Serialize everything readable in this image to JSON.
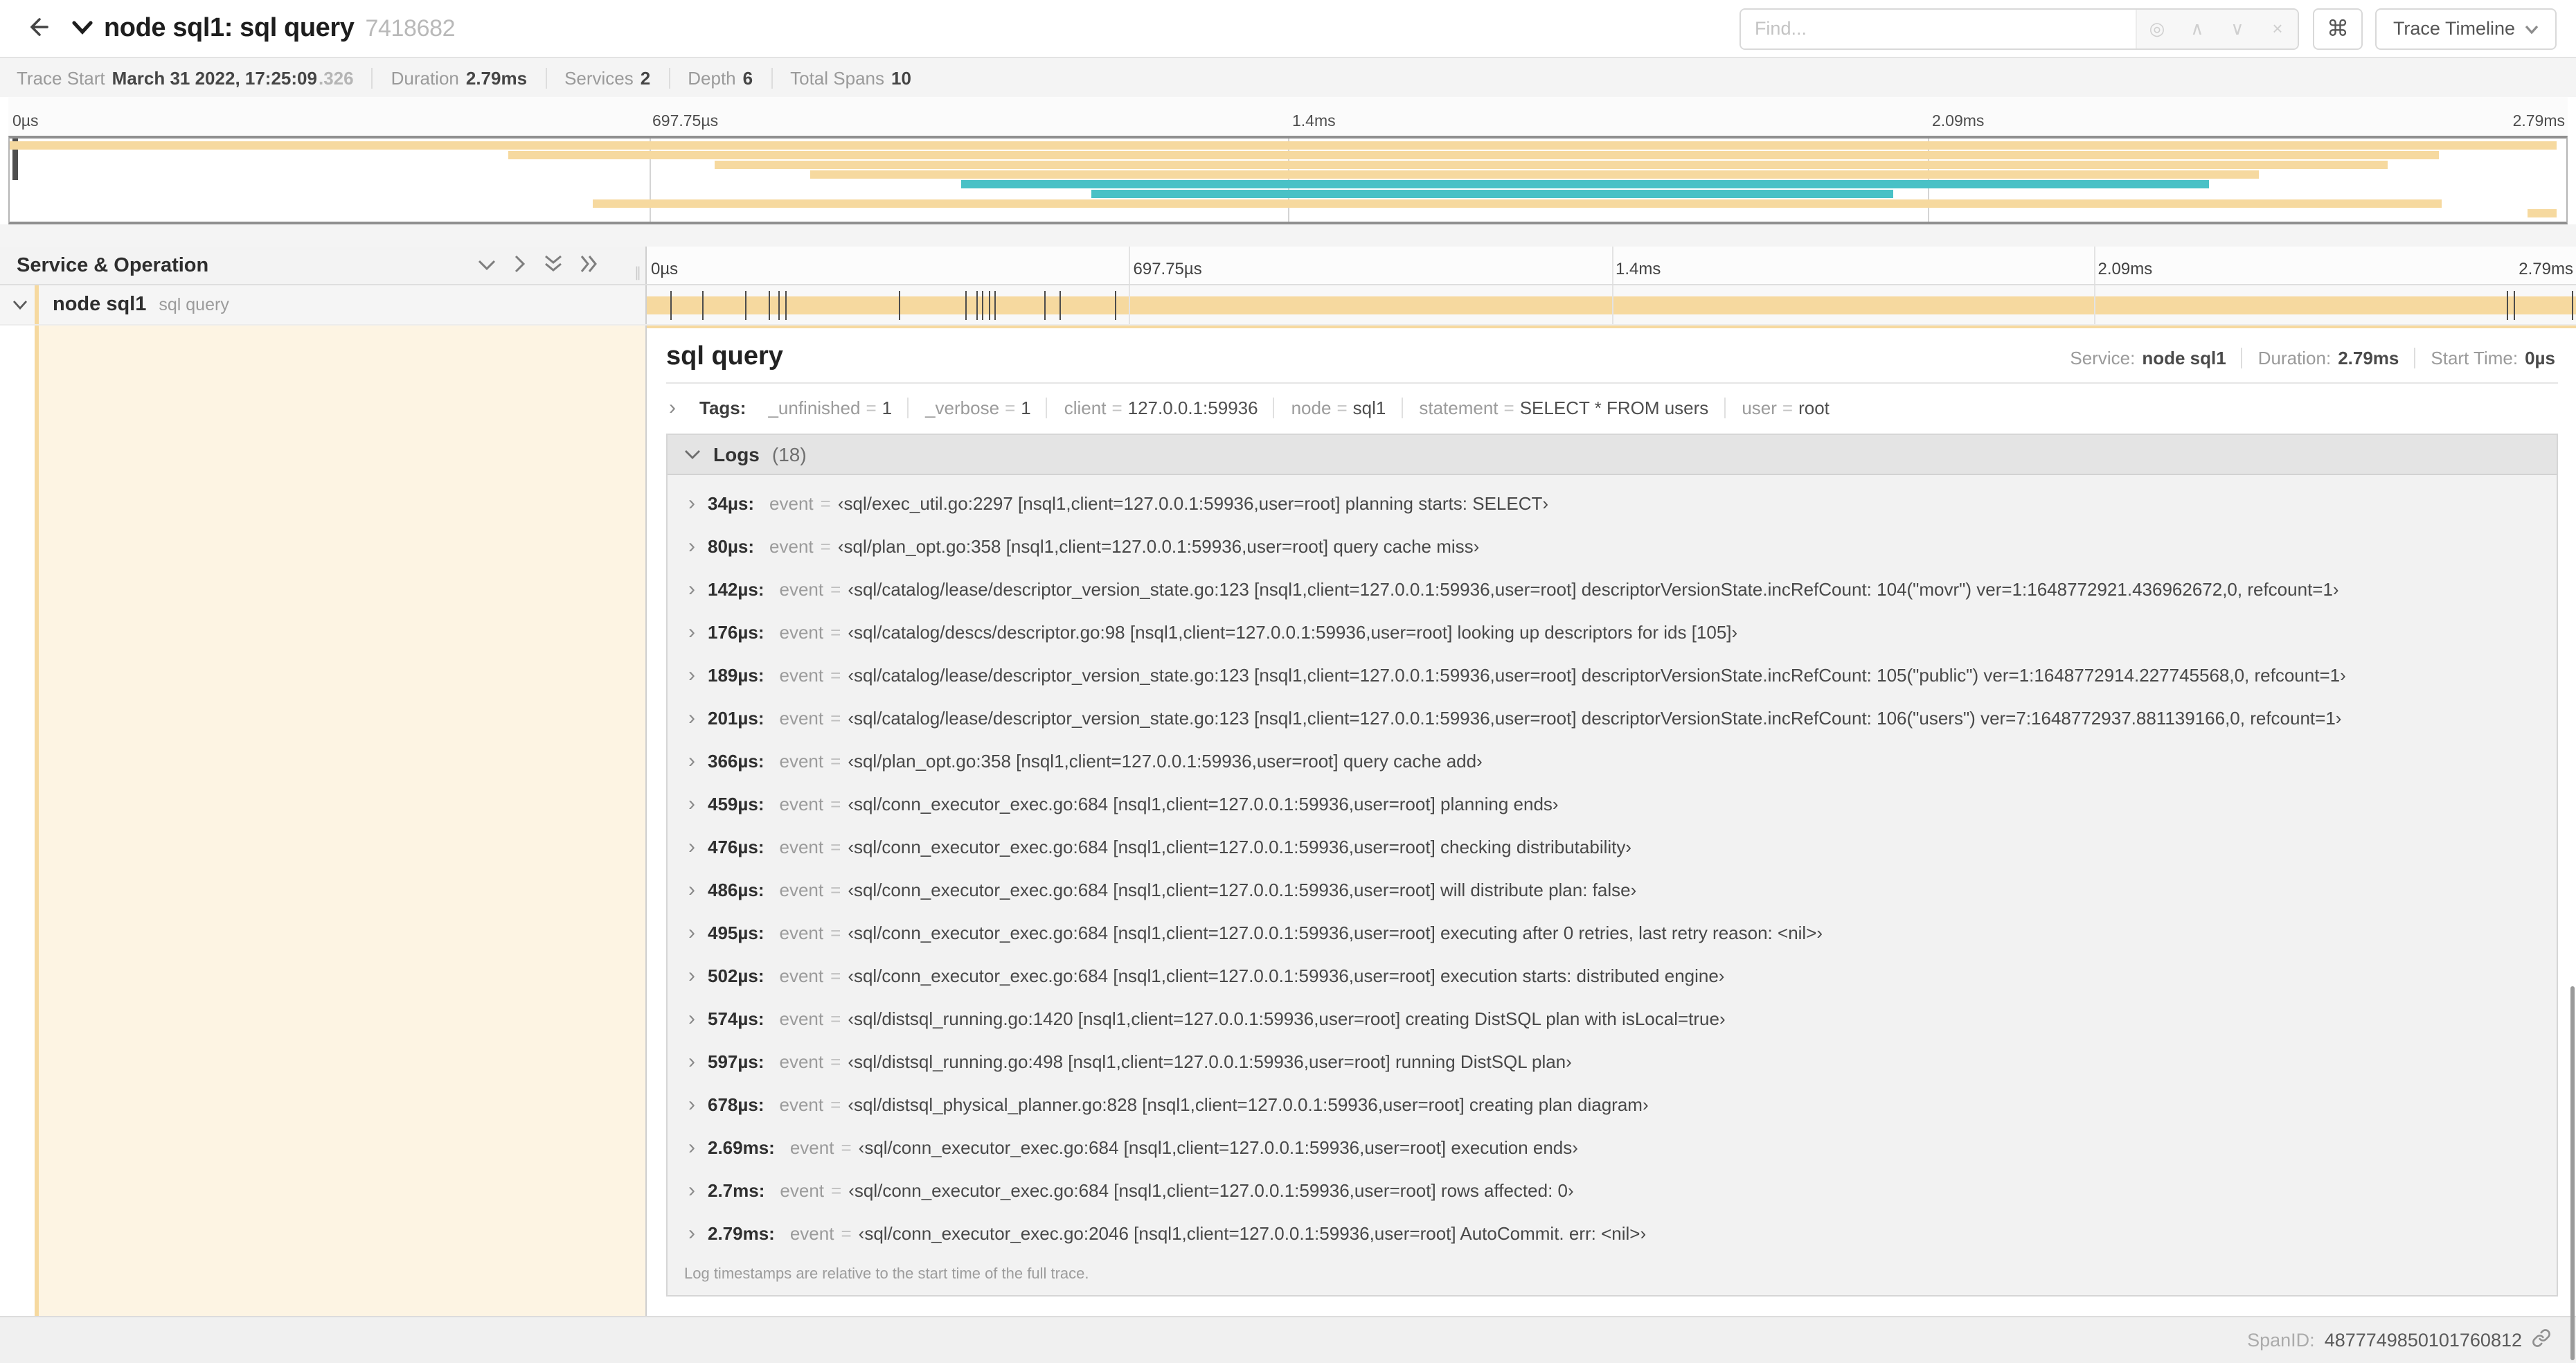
{
  "header": {
    "title": "node sql1: sql query",
    "trace_id": "7418682",
    "find_placeholder": "Find...",
    "view_selector_label": "Trace Timeline"
  },
  "icons": {
    "back": "←",
    "command": "⌘",
    "chevron_right": "›",
    "target": "◎",
    "caret_up": "∧",
    "caret_down": "∨",
    "close": "×",
    "grip": "∥"
  },
  "trace_meta": {
    "items": [
      {
        "label": "Trace Start",
        "value": "March 31 2022, 17:25:09",
        "suffix": ".326"
      },
      {
        "label": "Duration",
        "value": "2.79ms"
      },
      {
        "label": "Services",
        "value": "2"
      },
      {
        "label": "Depth",
        "value": "6"
      },
      {
        "label": "Total Spans",
        "value": "10"
      }
    ]
  },
  "ruler_ticks": [
    "0µs",
    "697.75µs",
    "1.4ms",
    "2.09ms",
    "2.79ms"
  ],
  "colors": {
    "span_tan": "#f6d99f",
    "span_teal": "#49c1c6",
    "cream_bg": "#fdf4e3"
  },
  "minimap": {
    "bars": [
      {
        "row": 0,
        "start": 0.0,
        "end": 0.996,
        "color": "tan"
      },
      {
        "row": 1,
        "start": 0.195,
        "end": 0.95,
        "color": "tan"
      },
      {
        "row": 2,
        "start": 0.276,
        "end": 0.93,
        "color": "tan"
      },
      {
        "row": 3,
        "start": 0.313,
        "end": 0.88,
        "color": "tan"
      },
      {
        "row": 4,
        "start": 0.372,
        "end": 0.86,
        "color": "teal"
      },
      {
        "row": 5,
        "start": 0.423,
        "end": 0.737,
        "color": "teal"
      },
      {
        "row": 6,
        "start": 0.228,
        "end": 0.951,
        "color": "tan"
      },
      {
        "row": 7,
        "start": 0.985,
        "end": 0.996,
        "color": "tan"
      }
    ]
  },
  "timeline": {
    "header_label": "Service & Operation",
    "span_row": {
      "service": "node sql1",
      "operation": "sql query"
    },
    "log_tick_fractions": [
      0.012,
      0.029,
      0.051,
      0.063,
      0.068,
      0.072,
      0.131,
      0.165,
      0.171,
      0.174,
      0.177,
      0.18,
      0.206,
      0.214,
      0.243,
      0.964,
      0.968,
      0.998
    ]
  },
  "detail": {
    "operation": "sql query",
    "eq": "=",
    "meta": [
      {
        "label": "Service:",
        "value": "node sql1"
      },
      {
        "label": "Duration:",
        "value": "2.79ms"
      },
      {
        "label": "Start Time:",
        "value": "0µs"
      }
    ],
    "tags_label": "Tags:",
    "tags": [
      {
        "key": "_unfinished",
        "value": "1"
      },
      {
        "key": "_verbose",
        "value": "1"
      },
      {
        "key": "client",
        "value": "127.0.0.1:59936"
      },
      {
        "key": "node",
        "value": "sql1"
      },
      {
        "key": "statement",
        "value": "SELECT * FROM users"
      },
      {
        "key": "user",
        "value": "root"
      }
    ],
    "logs_label": "Logs",
    "logs_count": "(18)",
    "logs": [
      {
        "time": "34µs:",
        "key": "event",
        "value": "‹sql/exec_util.go:2297 [nsql1,client=127.0.0.1:59936,user=root] planning starts: SELECT›"
      },
      {
        "time": "80µs:",
        "key": "event",
        "value": "‹sql/plan_opt.go:358 [nsql1,client=127.0.0.1:59936,user=root] query cache miss›"
      },
      {
        "time": "142µs:",
        "key": "event",
        "value": "‹sql/catalog/lease/descriptor_version_state.go:123 [nsql1,client=127.0.0.1:59936,user=root] descriptorVersionState.incRefCount: 104(\"movr\") ver=1:1648772921.436962672,0, refcount=1›"
      },
      {
        "time": "176µs:",
        "key": "event",
        "value": "‹sql/catalog/descs/descriptor.go:98 [nsql1,client=127.0.0.1:59936,user=root] looking up descriptors for ids [105]›"
      },
      {
        "time": "189µs:",
        "key": "event",
        "value": "‹sql/catalog/lease/descriptor_version_state.go:123 [nsql1,client=127.0.0.1:59936,user=root] descriptorVersionState.incRefCount: 105(\"public\") ver=1:1648772914.227745568,0, refcount=1›"
      },
      {
        "time": "201µs:",
        "key": "event",
        "value": "‹sql/catalog/lease/descriptor_version_state.go:123 [nsql1,client=127.0.0.1:59936,user=root] descriptorVersionState.incRefCount: 106(\"users\") ver=7:1648772937.881139166,0, refcount=1›"
      },
      {
        "time": "366µs:",
        "key": "event",
        "value": "‹sql/plan_opt.go:358 [nsql1,client=127.0.0.1:59936,user=root] query cache add›"
      },
      {
        "time": "459µs:",
        "key": "event",
        "value": "‹sql/conn_executor_exec.go:684 [nsql1,client=127.0.0.1:59936,user=root] planning ends›"
      },
      {
        "time": "476µs:",
        "key": "event",
        "value": "‹sql/conn_executor_exec.go:684 [nsql1,client=127.0.0.1:59936,user=root] checking distributability›"
      },
      {
        "time": "486µs:",
        "key": "event",
        "value": "‹sql/conn_executor_exec.go:684 [nsql1,client=127.0.0.1:59936,user=root] will distribute plan: false›"
      },
      {
        "time": "495µs:",
        "key": "event",
        "value": "‹sql/conn_executor_exec.go:684 [nsql1,client=127.0.0.1:59936,user=root] executing after 0 retries, last retry reason: <nil>›"
      },
      {
        "time": "502µs:",
        "key": "event",
        "value": "‹sql/conn_executor_exec.go:684 [nsql1,client=127.0.0.1:59936,user=root] execution starts: distributed engine›"
      },
      {
        "time": "574µs:",
        "key": "event",
        "value": "‹sql/distsql_running.go:1420 [nsql1,client=127.0.0.1:59936,user=root] creating DistSQL plan with isLocal=true›"
      },
      {
        "time": "597µs:",
        "key": "event",
        "value": "‹sql/distsql_running.go:498 [nsql1,client=127.0.0.1:59936,user=root] running DistSQL plan›"
      },
      {
        "time": "678µs:",
        "key": "event",
        "value": "‹sql/distsql_physical_planner.go:828 [nsql1,client=127.0.0.1:59936,user=root] creating plan diagram›"
      },
      {
        "time": "2.69ms:",
        "key": "event",
        "value": "‹sql/conn_executor_exec.go:684 [nsql1,client=127.0.0.1:59936,user=root] execution ends›"
      },
      {
        "time": "2.7ms:",
        "key": "event",
        "value": "‹sql/conn_executor_exec.go:684 [nsql1,client=127.0.0.1:59936,user=root] rows affected: 0›"
      },
      {
        "time": "2.79ms:",
        "key": "event",
        "value": "‹sql/conn_executor_exec.go:2046 [nsql1,client=127.0.0.1:59936,user=root] AutoCommit. err: <nil>›"
      }
    ],
    "logs_note": "Log timestamps are relative to the start time of the full trace.",
    "span_id_label": "SpanID:",
    "span_id_value": "4877749850101760812"
  }
}
